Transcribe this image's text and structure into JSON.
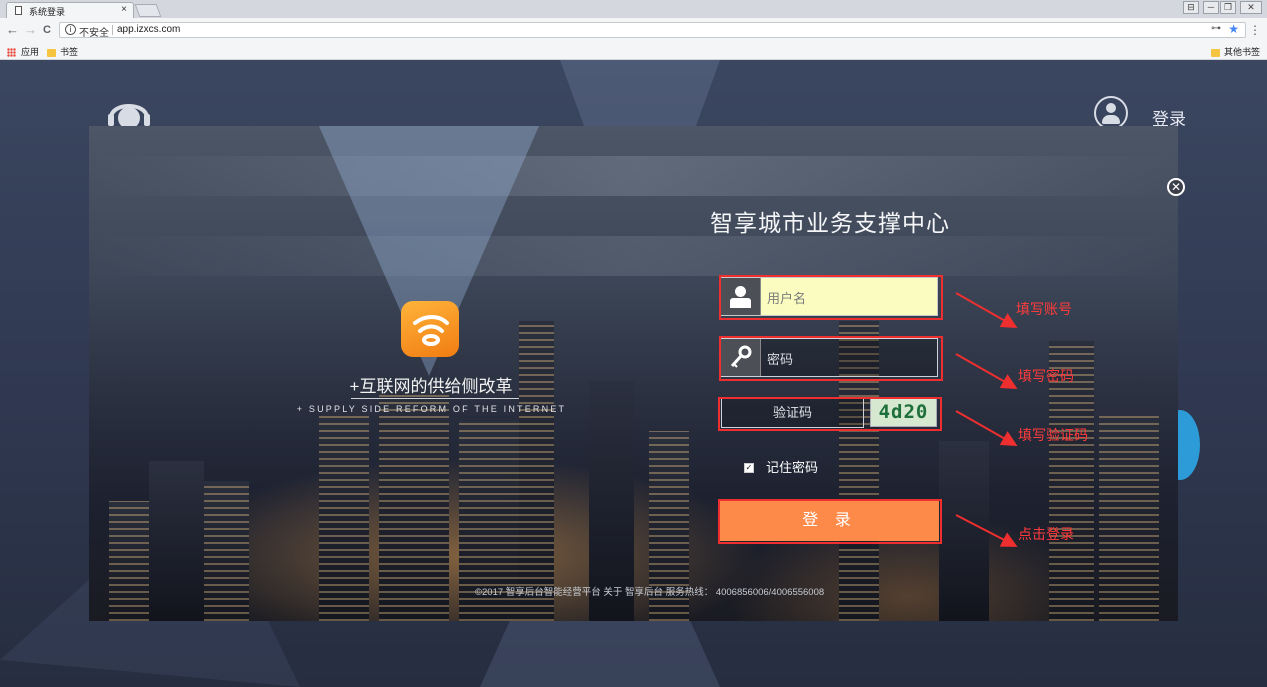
{
  "browser": {
    "tab_title": "系统登录",
    "tab_close": "×",
    "nav_back": "←",
    "nav_forward": "→",
    "nav_reload": "C",
    "security_label": "不安全",
    "info_icon": "i",
    "url": "app.izxcs.com",
    "key_icon": "⊶",
    "star_icon": "★",
    "menu_icon": "⋮",
    "bookmarks": {
      "apps": "应用",
      "bookmarks": "书签",
      "other": "其他书签"
    },
    "window_controls": [
      "⊟",
      "─",
      "❐",
      "✕"
    ]
  },
  "page": {
    "header_login": "登录"
  },
  "modal": {
    "close_icon": "✕",
    "slogan": "+互联网的供给侧改革",
    "slogan_en": "+ SUPPLY SIDE REFORM OF THE INTERNET",
    "title": "智享城市业务支撑中心",
    "username_placeholder": "用户名",
    "password_placeholder": "密码",
    "password_icon": "🔑",
    "captcha_placeholder": "验证码",
    "captcha_code": "4d20",
    "remember_label": "记住密码",
    "remember_checked": true,
    "login_button": "登 录",
    "footer": "©2017 智享后台智能经营平台 关于 智享后台 服务热线： 4006856006/4006556008"
  },
  "annotations": {
    "color": "#ef2f2f",
    "labels": [
      "填写账号",
      "填写密码",
      "填写验证码",
      "点击登录"
    ]
  },
  "colors": {
    "login_button": "#fe8a49",
    "username_bg": "#fafcc0",
    "app_logo": "#f59a23"
  }
}
